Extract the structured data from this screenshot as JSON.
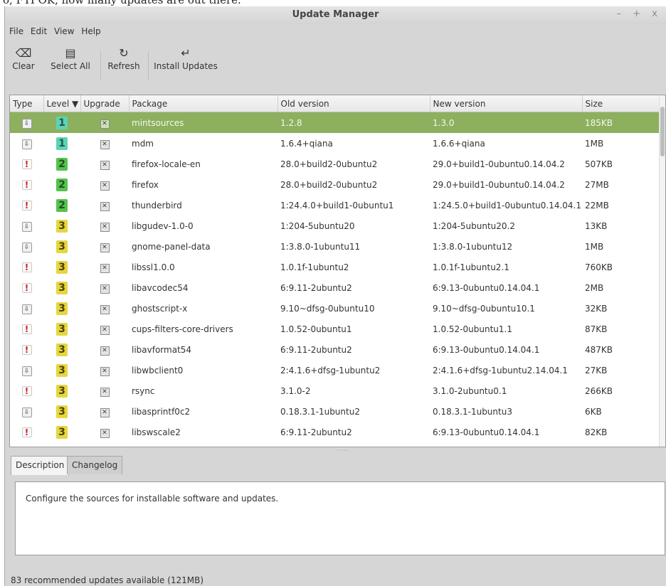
{
  "top_strip_text": "o, FYI OK, now many updates are out there.",
  "window": {
    "title": "Update Manager",
    "controls": [
      "–",
      "+",
      "x"
    ]
  },
  "menu": [
    "File",
    "Edit",
    "View",
    "Help"
  ],
  "toolbar": {
    "clear": "Clear",
    "select_all": "Select All",
    "refresh": "Refresh",
    "install": "Install Updates"
  },
  "columns": [
    "Type",
    "Level ▼",
    "Upgrade",
    "Package",
    "Old version",
    "New version",
    "Size"
  ],
  "rows": [
    {
      "type": "package",
      "level": "1",
      "package": "mintsources",
      "old": "1.2.8",
      "new": "1.3.0",
      "size": "185KB",
      "selected": true
    },
    {
      "type": "package",
      "level": "1",
      "package": "mdm",
      "old": "1.6.4+qiana",
      "new": "1.6.6+qiana",
      "size": "1MB"
    },
    {
      "type": "security",
      "level": "2",
      "package": "firefox-locale-en",
      "old": "28.0+build2-0ubuntu2",
      "new": "29.0+build1-0ubuntu0.14.04.2",
      "size": "507KB"
    },
    {
      "type": "security",
      "level": "2",
      "package": "firefox",
      "old": "28.0+build2-0ubuntu2",
      "new": "29.0+build1-0ubuntu0.14.04.2",
      "size": "27MB"
    },
    {
      "type": "security",
      "level": "2",
      "package": "thunderbird",
      "old": "1:24.4.0+build1-0ubuntu1",
      "new": "1:24.5.0+build1-0ubuntu0.14.04.1",
      "size": "22MB"
    },
    {
      "type": "package",
      "level": "3",
      "package": "libgudev-1.0-0",
      "old": "1:204-5ubuntu20",
      "new": "1:204-5ubuntu20.2",
      "size": "13KB"
    },
    {
      "type": "package",
      "level": "3",
      "package": "gnome-panel-data",
      "old": "1:3.8.0-1ubuntu11",
      "new": "1:3.8.0-1ubuntu12",
      "size": "1MB"
    },
    {
      "type": "security",
      "level": "3",
      "package": "libssl1.0.0",
      "old": "1.0.1f-1ubuntu2",
      "new": "1.0.1f-1ubuntu2.1",
      "size": "760KB"
    },
    {
      "type": "security",
      "level": "3",
      "package": "libavcodec54",
      "old": "6:9.11-2ubuntu2",
      "new": "6:9.13-0ubuntu0.14.04.1",
      "size": "2MB"
    },
    {
      "type": "package",
      "level": "3",
      "package": "ghostscript-x",
      "old": "9.10~dfsg-0ubuntu10",
      "new": "9.10~dfsg-0ubuntu10.1",
      "size": "32KB"
    },
    {
      "type": "security",
      "level": "3",
      "package": "cups-filters-core-drivers",
      "old": "1.0.52-0ubuntu1",
      "new": "1.0.52-0ubuntu1.1",
      "size": "87KB"
    },
    {
      "type": "security",
      "level": "3",
      "package": "libavformat54",
      "old": "6:9.11-2ubuntu2",
      "new": "6:9.13-0ubuntu0.14.04.1",
      "size": "487KB"
    },
    {
      "type": "package",
      "level": "3",
      "package": "libwbclient0",
      "old": "2:4.1.6+dfsg-1ubuntu2",
      "new": "2:4.1.6+dfsg-1ubuntu2.14.04.1",
      "size": "27KB"
    },
    {
      "type": "security",
      "level": "3",
      "package": "rsync",
      "old": "3.1.0-2",
      "new": "3.1.0-2ubuntu0.1",
      "size": "266KB"
    },
    {
      "type": "package",
      "level": "3",
      "package": "libasprintf0c2",
      "old": "0.18.3.1-1ubuntu2",
      "new": "0.18.3.1-1ubuntu3",
      "size": "6KB"
    },
    {
      "type": "security",
      "level": "3",
      "package": "libswscale2",
      "old": "6:9.11-2ubuntu2",
      "new": "6:9.13-0ubuntu0.14.04.1",
      "size": "82KB"
    },
    {
      "type": "package",
      "level": "3",
      "package": "",
      "old": "",
      "new": "",
      "size": ""
    }
  ],
  "tabs": {
    "description": "Description",
    "changelog": "Changelog"
  },
  "description_text": "Configure the sources for installable software and updates.",
  "status": "83 recommended updates available (121MB)",
  "icons": {
    "clear": "clear-icon",
    "select_all": "select-all-icon",
    "refresh": "refresh-icon",
    "install": "install-icon",
    "package": "package-icon",
    "security": "security-icon",
    "checkbox": "checkbox-icon"
  },
  "colors": {
    "selected_row": "#8db05e",
    "level1": "#5dd3b5",
    "level2": "#55c24e",
    "level3": "#e6d640",
    "security": "#d11f1f"
  }
}
